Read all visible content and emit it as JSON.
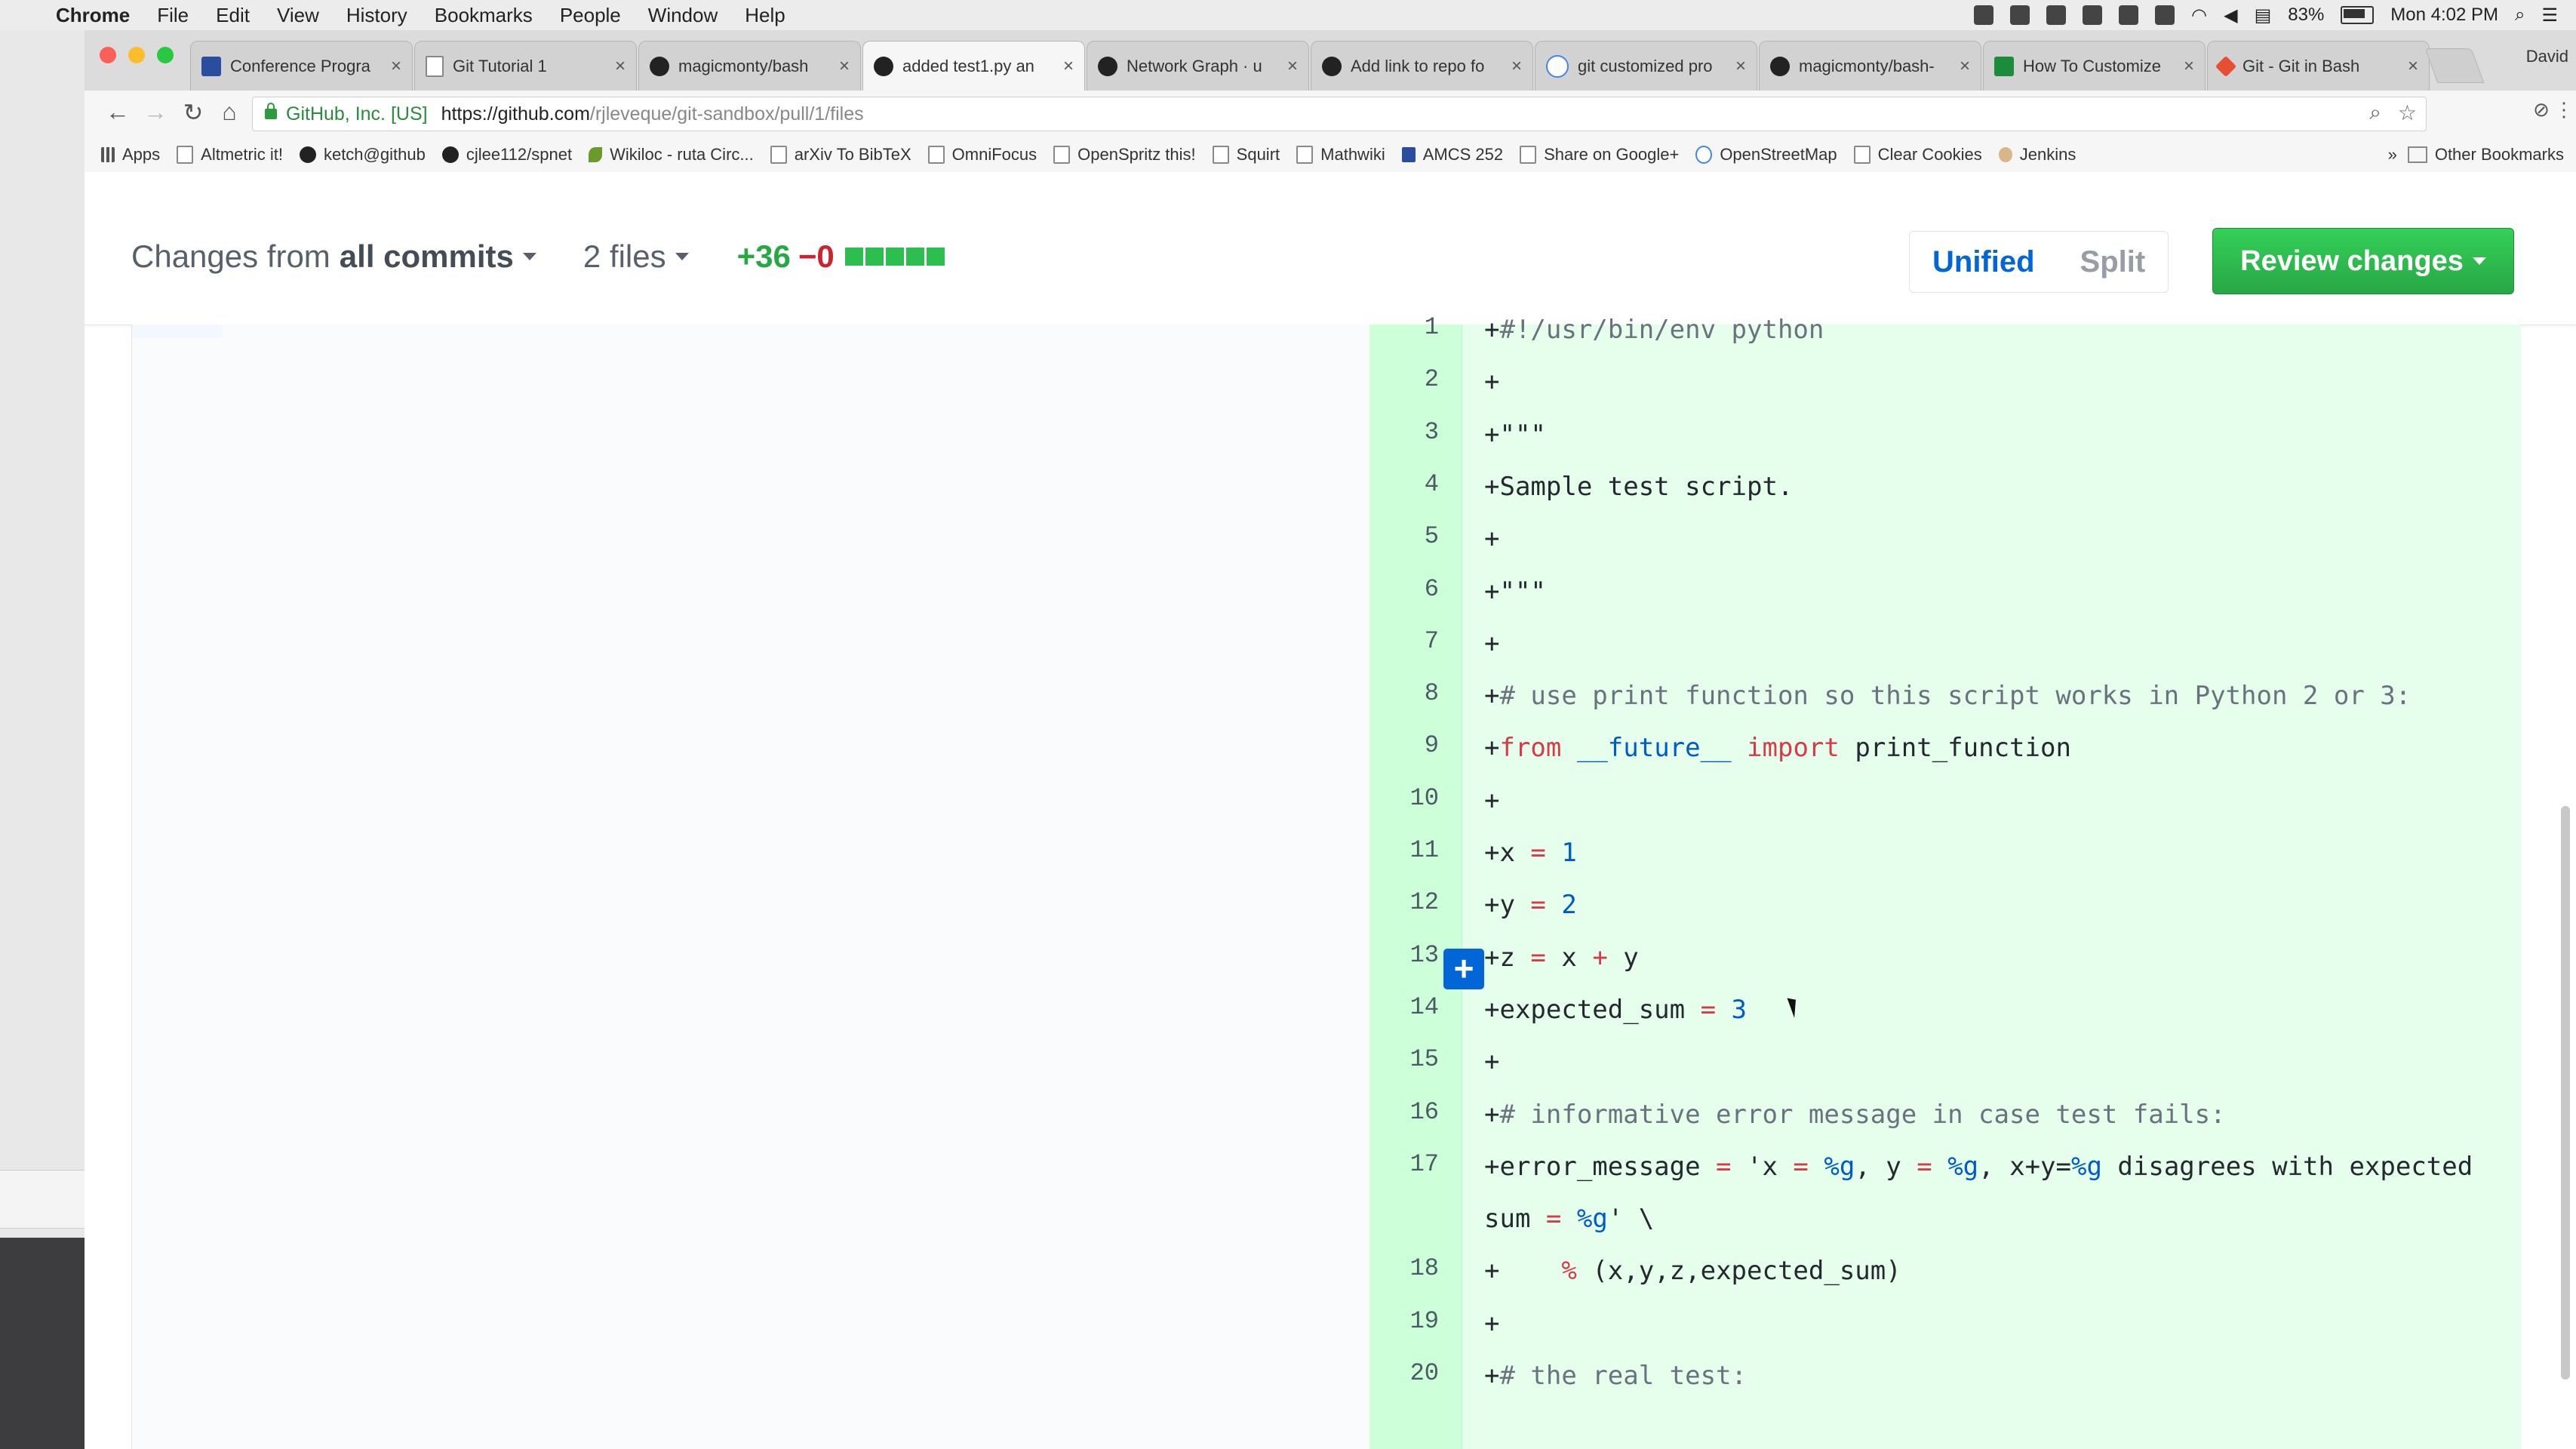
{
  "menubar": {
    "app": "Chrome",
    "items": [
      "File",
      "Edit",
      "View",
      "History",
      "Bookmarks",
      "People",
      "Window",
      "Help"
    ],
    "battery": "83%",
    "clock": "Mon 4:02 PM"
  },
  "tabs": [
    {
      "title": "Conference Progra",
      "icon": "conference-icon"
    },
    {
      "title": "Git Tutorial 1",
      "icon": "document-icon"
    },
    {
      "title": "magicmonty/bash",
      "icon": "github-icon"
    },
    {
      "title": "added test1.py an",
      "icon": "github-icon",
      "active": true
    },
    {
      "title": "Network Graph · u",
      "icon": "github-icon"
    },
    {
      "title": "Add link to repo fo",
      "icon": "github-icon"
    },
    {
      "title": "git customized pro",
      "icon": "google-icon"
    },
    {
      "title": "magicmonty/bash-",
      "icon": "github-icon"
    },
    {
      "title": "How To Customize",
      "icon": "site-icon"
    },
    {
      "title": "Git - Git in Bash",
      "icon": "git-icon"
    }
  ],
  "profile": "David",
  "omnibox": {
    "secure_label": "GitHub, Inc. [US]",
    "url_host": "https://github.com",
    "url_path": "/rjleveque/git-sandbox/pull/1/files"
  },
  "bookmarks": [
    {
      "label": "Apps",
      "icon": "apps-grid-icon"
    },
    {
      "label": "Altmetric it!",
      "icon": "page-icon"
    },
    {
      "label": "ketch@github",
      "icon": "github-icon"
    },
    {
      "label": "cjlee112/spnet",
      "icon": "github-icon"
    },
    {
      "label": "Wikiloc - ruta Circ...",
      "icon": "leaf-icon"
    },
    {
      "label": "arXiv To BibTeX",
      "icon": "page-icon"
    },
    {
      "label": "OmniFocus",
      "icon": "page-icon"
    },
    {
      "label": "OpenSpritz this!",
      "icon": "page-icon"
    },
    {
      "label": "Squirt",
      "icon": "page-icon"
    },
    {
      "label": "Mathwiki",
      "icon": "page-icon"
    },
    {
      "label": "AMCS 252",
      "icon": "blue-square-icon"
    },
    {
      "label": "Share on Google+",
      "icon": "page-icon"
    },
    {
      "label": "OpenStreetMap",
      "icon": "google-icon"
    },
    {
      "label": "Clear Cookies",
      "icon": "page-icon"
    },
    {
      "label": "Jenkins",
      "icon": "jenkins-icon"
    }
  ],
  "bookmarks_other": "Other Bookmarks",
  "prbar": {
    "changes_from": "Changes from",
    "commits": "all commits",
    "files": "2 files",
    "additions": "+36",
    "deletions": "−0",
    "unified": "Unified",
    "split": "Split",
    "review": "Review changes"
  },
  "diff_lines": [
    {
      "n": "1",
      "t": "+#!/usr/bin/env python"
    },
    {
      "n": "2",
      "t": "+"
    },
    {
      "n": "3",
      "t": "+\"\"\""
    },
    {
      "n": "4",
      "t": "+Sample test script."
    },
    {
      "n": "5",
      "t": "+"
    },
    {
      "n": "6",
      "t": "+\"\"\""
    },
    {
      "n": "7",
      "t": "+"
    },
    {
      "n": "8",
      "t": "+# use print function so this script works in Python 2 or 3:"
    },
    {
      "n": "9",
      "t": "+from __future__ import print_function"
    },
    {
      "n": "10",
      "t": "+"
    },
    {
      "n": "11",
      "t": "+x = 1"
    },
    {
      "n": "12",
      "t": "+y = 2"
    },
    {
      "n": "13",
      "t": "+z = x + y"
    },
    {
      "n": "14",
      "t": "+expected_sum = 3"
    },
    {
      "n": "15",
      "t": "+"
    },
    {
      "n": "16",
      "t": "+# informative error message in case test fails:"
    },
    {
      "n": "17",
      "t": "+error_message = 'x = %g, y = %g, x+y=%g disagrees with expected"
    },
    {
      "n": "",
      "t": "sum = %g' \\"
    },
    {
      "n": "18",
      "t": "+    % (x,y,z,expected_sum)"
    },
    {
      "n": "19",
      "t": "+"
    },
    {
      "n": "20",
      "t": "+# the real test:"
    }
  ]
}
